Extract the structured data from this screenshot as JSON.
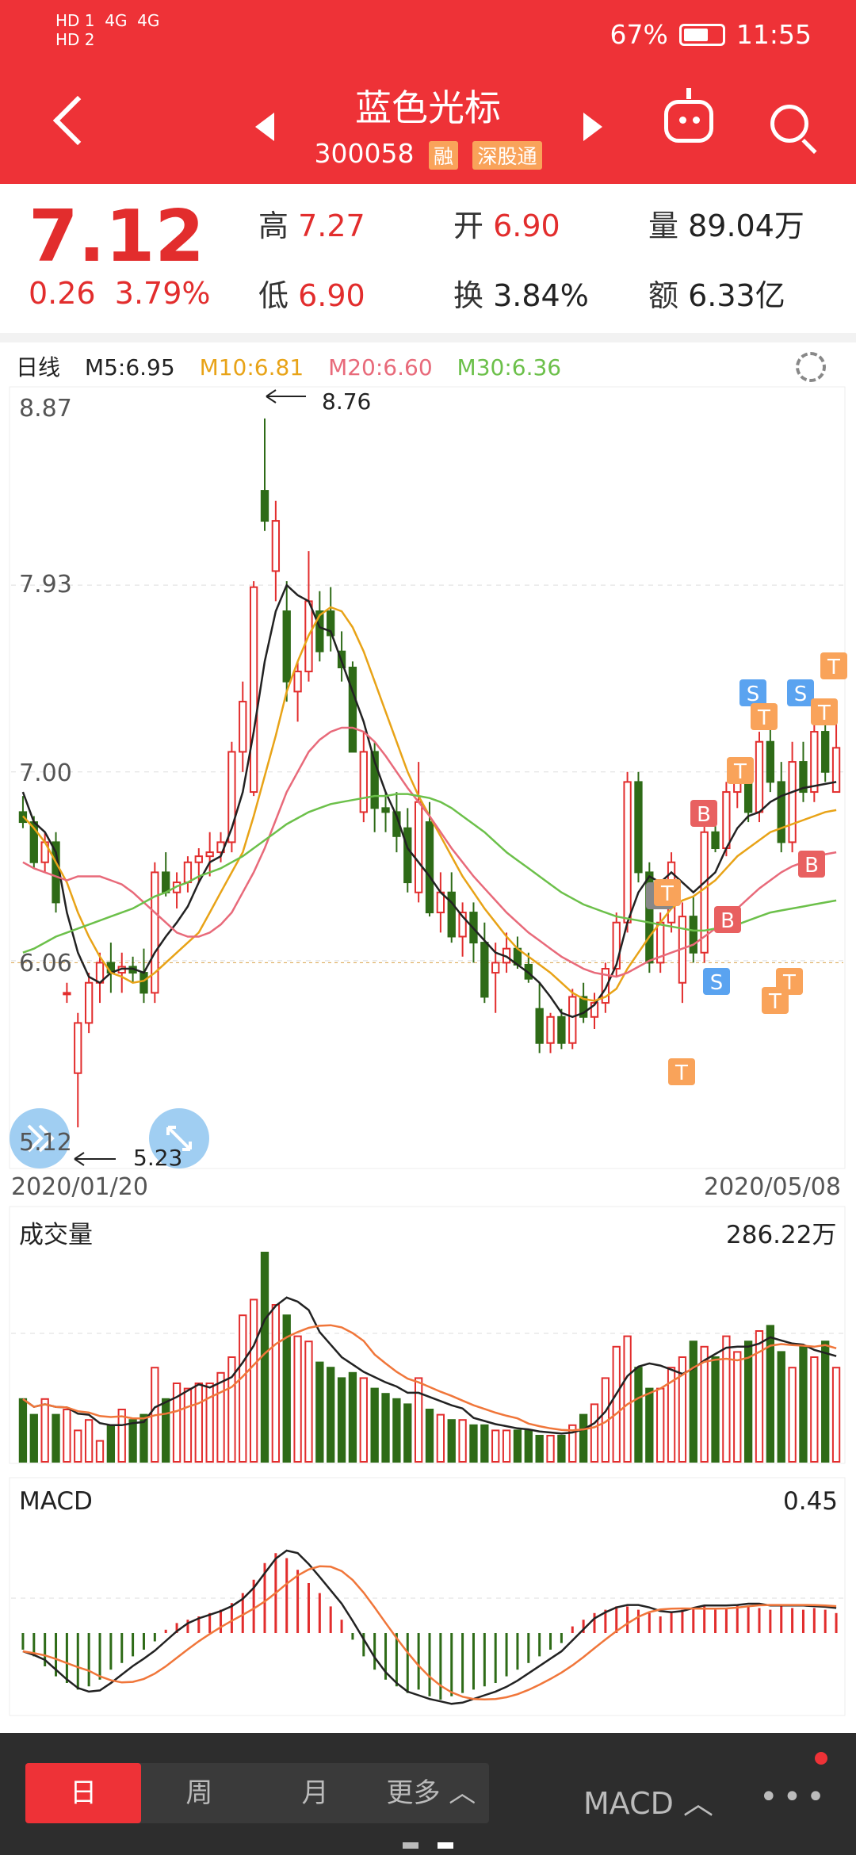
{
  "status": {
    "signal_left": "HD 1  4G  4G\nHD 2",
    "battery": "67%",
    "time": "11:55"
  },
  "header": {
    "name": "蓝色光标",
    "code": "300058",
    "tag1": "融",
    "tag2": "深股通"
  },
  "quote": {
    "price": "7.12",
    "change": "0.26",
    "change_pct": "3.79%",
    "high_label": "高",
    "high": "7.27",
    "low_label": "低",
    "low": "6.90",
    "open_label": "开",
    "open": "6.90",
    "turnover_label": "换",
    "turnover": "3.84%",
    "volume_label": "量",
    "volume": "89.04万",
    "amount_label": "额",
    "amount": "6.33亿"
  },
  "ma": {
    "label": "日线",
    "m5": "M5:6.95",
    "m10": "M10:6.81",
    "m20": "M20:6.60",
    "m30": "M30:6.36"
  },
  "colors": {
    "red": "#e22d2d",
    "green": "#2e6b17",
    "m5": "#222222",
    "m10": "#e8a317",
    "m20": "#e86a7a",
    "m30": "#6cc04a",
    "orange_line": "#f0763a",
    "tag_orange": "#f9a35a",
    "tag_blue": "#5aa3f0",
    "tag_red": "#e86060"
  },
  "chart_data": [
    {
      "type": "candlestick",
      "title": "",
      "ylim": [
        5.12,
        8.87
      ],
      "y_ticks": [
        "8.87",
        "7.93",
        "7.00",
        "6.06",
        "5.12"
      ],
      "x_start": "2020/01/20",
      "x_end": "2020/05/08",
      "max_label": "8.76",
      "min_label": "5.23",
      "ohlc": [
        [
          6.8,
          6.88,
          6.72,
          6.75
        ],
        [
          6.75,
          6.78,
          6.52,
          6.55
        ],
        [
          6.55,
          6.7,
          6.5,
          6.65
        ],
        [
          6.65,
          6.7,
          6.3,
          6.35
        ],
        [
          5.9,
          5.95,
          5.85,
          5.9
        ],
        [
          5.5,
          5.8,
          5.23,
          5.75
        ],
        [
          5.75,
          6.0,
          5.7,
          5.95
        ],
        [
          5.95,
          6.1,
          5.85,
          6.05
        ],
        [
          6.05,
          6.15,
          5.9,
          6.0
        ],
        [
          6.0,
          6.1,
          5.9,
          6.03
        ],
        [
          6.03,
          6.08,
          5.95,
          6.0
        ],
        [
          6.0,
          6.12,
          5.85,
          5.9
        ],
        [
          5.9,
          6.55,
          5.85,
          6.5
        ],
        [
          6.5,
          6.6,
          6.38,
          6.4
        ],
        [
          6.4,
          6.5,
          6.32,
          6.45
        ],
        [
          6.45,
          6.58,
          6.4,
          6.55
        ],
        [
          6.55,
          6.62,
          6.45,
          6.58
        ],
        [
          6.58,
          6.7,
          6.48,
          6.6
        ],
        [
          6.6,
          6.7,
          6.55,
          6.65
        ],
        [
          6.65,
          7.15,
          6.6,
          7.1
        ],
        [
          7.1,
          7.45,
          7.0,
          7.35
        ],
        [
          6.9,
          7.95,
          6.88,
          7.92
        ],
        [
          8.4,
          8.76,
          8.2,
          8.25
        ],
        [
          8.0,
          8.35,
          7.85,
          8.25
        ],
        [
          7.8,
          7.95,
          7.35,
          7.45
        ],
        [
          7.4,
          7.55,
          7.25,
          7.5
        ],
        [
          7.5,
          8.1,
          7.45,
          7.85
        ],
        [
          7.8,
          7.9,
          7.55,
          7.6
        ],
        [
          7.8,
          7.92,
          7.6,
          7.68
        ],
        [
          7.6,
          7.7,
          7.45,
          7.52
        ],
        [
          7.52,
          7.55,
          7.1,
          7.1
        ],
        [
          6.8,
          7.2,
          6.75,
          7.1
        ],
        [
          7.1,
          7.15,
          6.7,
          6.82
        ],
        [
          6.82,
          6.9,
          6.7,
          6.8
        ],
        [
          6.8,
          6.9,
          6.6,
          6.68
        ],
        [
          6.72,
          6.82,
          6.4,
          6.45
        ],
        [
          6.4,
          7.05,
          6.35,
          6.85
        ],
        [
          6.75,
          6.85,
          6.28,
          6.3
        ],
        [
          6.3,
          6.5,
          6.2,
          6.4
        ],
        [
          6.4,
          6.5,
          6.15,
          6.18
        ],
        [
          6.18,
          6.35,
          6.08,
          6.3
        ],
        [
          6.3,
          6.35,
          6.05,
          6.15
        ],
        [
          6.15,
          6.25,
          5.85,
          5.88
        ],
        [
          6.0,
          6.15,
          5.8,
          6.05
        ],
        [
          6.05,
          6.2,
          6.0,
          6.12
        ],
        [
          6.12,
          6.18,
          6.02,
          6.04
        ],
        [
          6.04,
          6.1,
          5.95,
          5.97
        ],
        [
          5.82,
          5.95,
          5.6,
          5.65
        ],
        [
          5.65,
          5.8,
          5.6,
          5.78
        ],
        [
          5.78,
          5.82,
          5.62,
          5.65
        ],
        [
          5.65,
          5.92,
          5.62,
          5.88
        ],
        [
          5.88,
          5.95,
          5.75,
          5.78
        ],
        [
          5.78,
          5.9,
          5.72,
          5.85
        ],
        [
          5.85,
          6.05,
          5.8,
          6.02
        ],
        [
          6.02,
          6.3,
          5.98,
          6.25
        ],
        [
          6.25,
          7.0,
          6.2,
          6.95
        ],
        [
          6.95,
          7.0,
          6.45,
          6.5
        ],
        [
          6.5,
          6.55,
          6.0,
          6.05
        ],
        [
          6.05,
          6.3,
          6.0,
          6.25
        ],
        [
          6.25,
          6.6,
          6.2,
          6.55
        ],
        [
          5.95,
          6.35,
          5.85,
          6.28
        ],
        [
          6.28,
          6.38,
          6.05,
          6.1
        ],
        [
          6.1,
          6.8,
          6.05,
          6.7
        ],
        [
          6.7,
          6.85,
          6.6,
          6.62
        ],
        [
          6.62,
          6.95,
          6.58,
          6.9
        ],
        [
          6.9,
          7.05,
          6.82,
          6.95
        ],
        [
          6.95,
          7.0,
          6.75,
          6.8
        ],
        [
          6.8,
          7.2,
          6.75,
          7.15
        ],
        [
          7.15,
          7.27,
          6.9,
          6.95
        ],
        [
          6.95,
          7.05,
          6.6,
          6.65
        ],
        [
          6.65,
          7.15,
          6.6,
          7.05
        ],
        [
          7.05,
          7.15,
          6.85,
          6.9
        ],
        [
          6.9,
          7.25,
          6.85,
          7.2
        ],
        [
          7.2,
          7.3,
          6.95,
          7.0
        ],
        [
          6.9,
          7.27,
          6.9,
          7.12
        ]
      ],
      "series": [
        {
          "name": "M5",
          "values": [
            6.9,
            6.75,
            6.7,
            6.6,
            6.3,
            6.1,
            5.98,
            5.95,
            6.0,
            6.02,
            6.02,
            6.0,
            6.1,
            6.18,
            6.25,
            6.33,
            6.45,
            6.55,
            6.58,
            6.72,
            6.9,
            7.2,
            7.55,
            7.8,
            7.93,
            7.88,
            7.85,
            7.72,
            7.7,
            7.55,
            7.4,
            7.25,
            7.05,
            6.9,
            6.78,
            6.62,
            6.55,
            6.48,
            6.4,
            6.35,
            6.28,
            6.22,
            6.16,
            6.1,
            6.08,
            6.04,
            6.0,
            5.95,
            5.88,
            5.8,
            5.78,
            5.8,
            5.84,
            5.92,
            6.04,
            6.25,
            6.4,
            6.48,
            6.45,
            6.5,
            6.45,
            6.4,
            6.45,
            6.5,
            6.62,
            6.72,
            6.78,
            6.8,
            6.85,
            6.88,
            6.9,
            6.92,
            6.93,
            6.94,
            6.95
          ]
        },
        {
          "name": "M10",
          "values": [
            6.78,
            6.72,
            6.65,
            6.55,
            6.45,
            6.3,
            6.18,
            6.08,
            6.0,
            5.98,
            5.95,
            5.96,
            6.0,
            6.05,
            6.1,
            6.15,
            6.2,
            6.3,
            6.4,
            6.5,
            6.6,
            6.78,
            6.98,
            7.18,
            7.4,
            7.55,
            7.68,
            7.78,
            7.82,
            7.8,
            7.72,
            7.6,
            7.45,
            7.3,
            7.15,
            7.0,
            6.88,
            6.78,
            6.68,
            6.58,
            6.48,
            6.4,
            6.32,
            6.25,
            6.18,
            6.12,
            6.08,
            6.04,
            6.0,
            5.95,
            5.9,
            5.87,
            5.86,
            5.88,
            5.92,
            6.02,
            6.1,
            6.18,
            6.25,
            6.32,
            6.36,
            6.38,
            6.42,
            6.46,
            6.52,
            6.58,
            6.62,
            6.66,
            6.7,
            6.72,
            6.74,
            6.76,
            6.78,
            6.8,
            6.81
          ]
        },
        {
          "name": "M20",
          "values": [
            6.55,
            6.52,
            6.5,
            6.48,
            6.46,
            6.48,
            6.48,
            6.48,
            6.46,
            6.44,
            6.4,
            6.35,
            6.3,
            6.25,
            6.2,
            6.18,
            6.18,
            6.2,
            6.24,
            6.3,
            6.4,
            6.5,
            6.62,
            6.76,
            6.9,
            7.0,
            7.1,
            7.16,
            7.2,
            7.22,
            7.22,
            7.2,
            7.15,
            7.08,
            7.0,
            6.92,
            6.85,
            6.78,
            6.7,
            6.62,
            6.55,
            6.48,
            6.42,
            6.36,
            6.3,
            6.25,
            6.2,
            6.16,
            6.12,
            6.08,
            6.05,
            6.02,
            6.0,
            5.99,
            5.98,
            6.0,
            6.03,
            6.06,
            6.08,
            6.1,
            6.12,
            6.14,
            6.18,
            6.22,
            6.27,
            6.32,
            6.37,
            6.42,
            6.46,
            6.5,
            6.53,
            6.55,
            6.57,
            6.59,
            6.6
          ]
        },
        {
          "name": "M30",
          "values": [
            6.1,
            6.12,
            6.15,
            6.18,
            6.2,
            6.22,
            6.24,
            6.26,
            6.28,
            6.3,
            6.32,
            6.35,
            6.38,
            6.4,
            6.43,
            6.45,
            6.48,
            6.5,
            6.52,
            6.55,
            6.58,
            6.62,
            6.66,
            6.7,
            6.74,
            6.77,
            6.8,
            6.82,
            6.84,
            6.85,
            6.86,
            6.87,
            6.88,
            6.88,
            6.89,
            6.89,
            6.88,
            6.87,
            6.85,
            6.82,
            6.78,
            6.74,
            6.7,
            6.65,
            6.6,
            6.56,
            6.52,
            6.48,
            6.44,
            6.4,
            6.37,
            6.34,
            6.32,
            6.3,
            6.28,
            6.27,
            6.26,
            6.25,
            6.24,
            6.23,
            6.22,
            6.21,
            6.21,
            6.22,
            6.23,
            6.24,
            6.26,
            6.28,
            6.3,
            6.31,
            6.32,
            6.33,
            6.34,
            6.35,
            6.36
          ]
        }
      ]
    },
    {
      "type": "bar",
      "title": "成交量",
      "value_label": "286.22万",
      "values": [
        60,
        45,
        60,
        45,
        50,
        30,
        40,
        20,
        35,
        50,
        40,
        45,
        90,
        60,
        75,
        70,
        75,
        75,
        85,
        100,
        140,
        155,
        200,
        150,
        140,
        120,
        115,
        95,
        90,
        80,
        85,
        80,
        70,
        65,
        60,
        55,
        80,
        50,
        45,
        40,
        40,
        35,
        35,
        30,
        30,
        30,
        30,
        25,
        25,
        25,
        35,
        45,
        55,
        80,
        110,
        120,
        90,
        70,
        70,
        90,
        100,
        115,
        110,
        100,
        120,
        105,
        115,
        125,
        130,
        105,
        90,
        110,
        100,
        115,
        90
      ]
    },
    {
      "type": "bar",
      "title": "MACD",
      "value_label": "0.45",
      "values": [
        -0.1,
        -0.14,
        -0.2,
        -0.26,
        -0.3,
        -0.34,
        -0.32,
        -0.28,
        -0.22,
        -0.18,
        -0.14,
        -0.1,
        -0.05,
        0.02,
        0.06,
        0.08,
        0.1,
        0.12,
        0.14,
        0.18,
        0.24,
        0.32,
        0.42,
        0.48,
        0.45,
        0.38,
        0.3,
        0.24,
        0.16,
        0.08,
        -0.04,
        -0.14,
        -0.22,
        -0.28,
        -0.32,
        -0.36,
        -0.34,
        -0.38,
        -0.4,
        -0.38,
        -0.36,
        -0.34,
        -0.32,
        -0.3,
        -0.26,
        -0.22,
        -0.18,
        -0.14,
        -0.1,
        -0.06,
        0.04,
        0.08,
        0.12,
        0.14,
        0.16,
        0.16,
        0.14,
        0.12,
        0.1,
        0.12,
        0.14,
        0.15,
        0.16,
        0.14,
        0.15,
        0.17,
        0.16,
        0.15,
        0.14,
        0.16,
        0.15,
        0.14,
        0.15,
        0.14,
        0.12
      ]
    }
  ],
  "bottom": {
    "day": "日",
    "week": "周",
    "month": "月",
    "more": "更多 ︿",
    "indicator": "MACD ︿",
    "menu": "•••"
  }
}
